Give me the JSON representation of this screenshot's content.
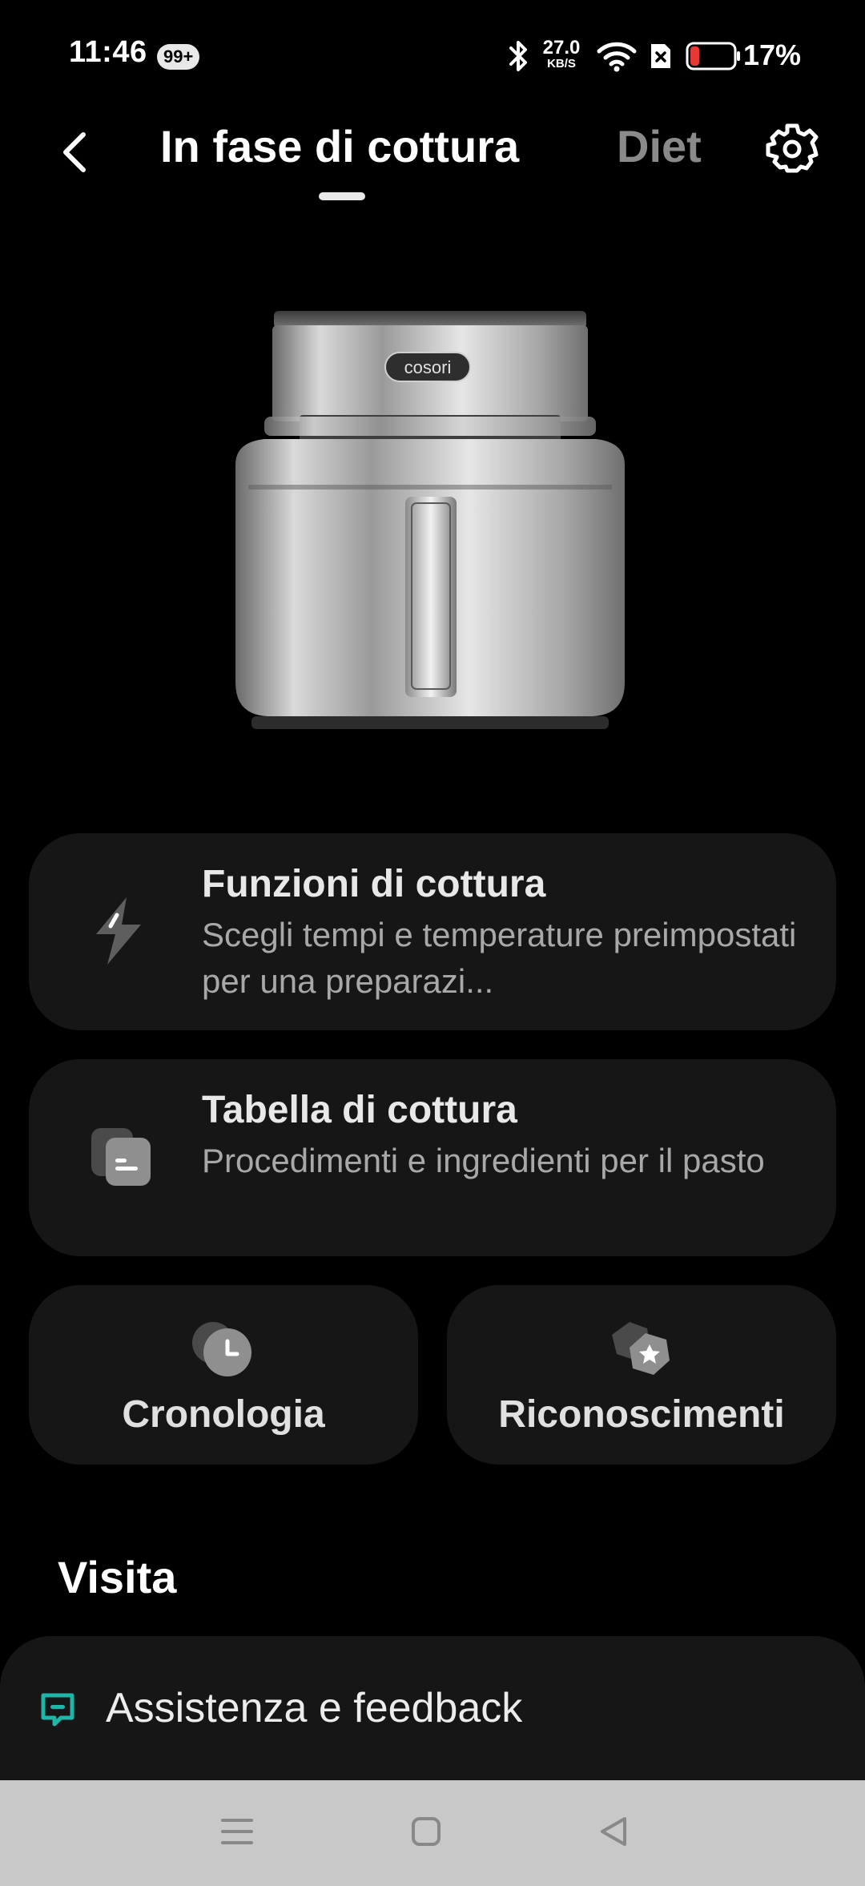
{
  "status_bar": {
    "time": "11:46",
    "notification_badge": "99+",
    "net_speed_value": "27.0",
    "net_speed_unit": "KB/S",
    "battery_percent": "17%",
    "icons": [
      "bluetooth-icon",
      "wifi-icon",
      "sim-off-icon",
      "battery-icon"
    ]
  },
  "header": {
    "tabs": [
      {
        "label": "In fase di cottura",
        "active": true
      },
      {
        "label": "Diet",
        "active": false
      }
    ],
    "icons": [
      "back-arrow-icon",
      "gear-icon"
    ]
  },
  "product": {
    "brand_logo": "cosori"
  },
  "cards": [
    {
      "title": "Funzioni di cottura",
      "desc": "Scegli tempi e temperature preimpostati per una preparazi...",
      "icon": "lightning-icon"
    },
    {
      "title": "Tabella di cottura",
      "desc": "Procedimenti e ingredienti per il pasto",
      "icon": "recipe-card-icon"
    }
  ],
  "small_cards": [
    {
      "label": "Cronologia",
      "icon": "clock-icon"
    },
    {
      "label": "Riconoscimenti",
      "icon": "star-badge-icon"
    }
  ],
  "section": {
    "visit_title": "Visita"
  },
  "support": {
    "label": "Assistenza e feedback",
    "icon": "chat-icon",
    "accent_color": "#1fb5a8"
  },
  "nav_bar": {
    "icons": [
      "menu-icon",
      "home-icon",
      "back-icon"
    ]
  }
}
